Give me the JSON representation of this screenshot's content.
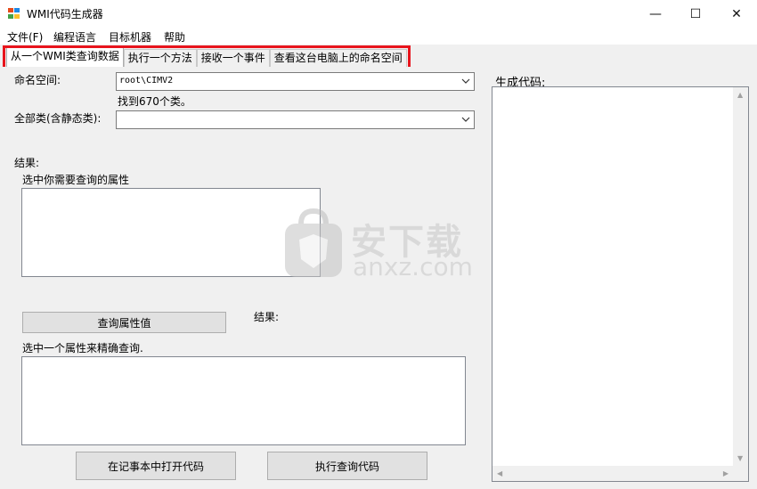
{
  "window": {
    "title": "WMI代码生成器",
    "minimize_glyph": "—",
    "maximize_glyph": "☐",
    "close_glyph": "✕"
  },
  "menu": {
    "items": [
      "文件(F)",
      "编程语言",
      "目标机器",
      "帮助"
    ]
  },
  "tabs": [
    {
      "label": "从一个WMI类查询数据",
      "active": true
    },
    {
      "label": "执行一个方法",
      "active": false
    },
    {
      "label": "接收一个事件",
      "active": false
    },
    {
      "label": "查看这台电脑上的命名空间",
      "active": false
    }
  ],
  "query_tab": {
    "namespace_label": "命名空间:",
    "namespace_value": "root\\CIMV2",
    "classes_found": "找到670个类。",
    "all_classes_label": "全部类(含静态类):",
    "all_classes_value": "",
    "results_label": "结果:",
    "select_properties_label": "选中你需要查询的属性",
    "query_values_button": "查询属性值",
    "results_label_2": "结果:",
    "select_property_exact_label": "选中一个属性来精确查询.",
    "open_notepad_button": "在记事本中打开代码",
    "execute_code_button": "执行查询代码"
  },
  "right_panel": {
    "generated_code_label": "生成代码:",
    "generated_code": ""
  },
  "watermark": {
    "text": "安下载",
    "sub": "anxz.com"
  },
  "colors": {
    "highlight_border": "#e8141c",
    "client_bg": "#f0f0f0"
  }
}
